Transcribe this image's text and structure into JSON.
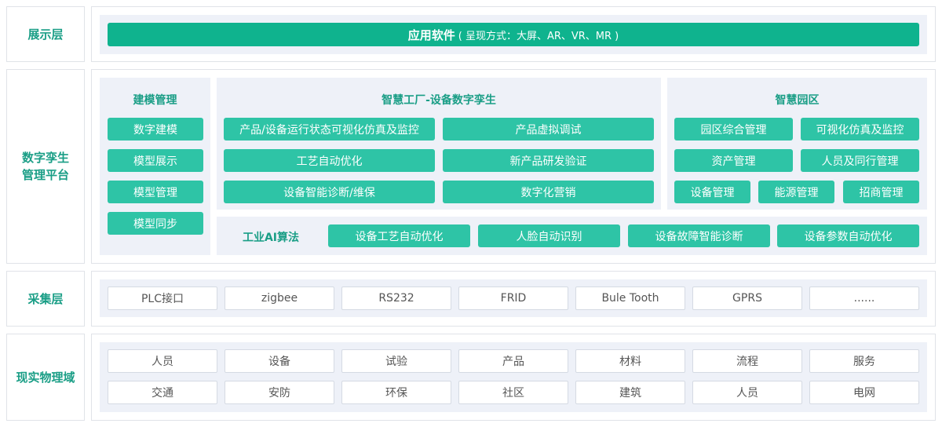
{
  "layers": {
    "display": "展示层",
    "twin": "数字孪生\n管理平台",
    "collect": "采集层",
    "physical": "现实物理域"
  },
  "display_bar": {
    "title": "应用软件",
    "detail": "( 呈现方式：大屏、AR、VR、MR )"
  },
  "modeling": {
    "title": "建模管理",
    "items": [
      "数字建模",
      "模型展示",
      "模型管理",
      "模型同步"
    ]
  },
  "factory": {
    "title": "智慧工厂-设备数字孪生",
    "items": [
      "产品/设备运行状态可视化仿真及监控",
      "产品虚拟调试",
      "工艺自动优化",
      "新产品研发验证",
      "设备智能诊断/维保",
      "数字化营销"
    ]
  },
  "park": {
    "title": "智慧园区",
    "items": [
      "园区综合管理",
      "可视化仿真及监控",
      "资产管理",
      "人员及同行管理",
      "设备管理",
      "能源管理",
      "招商管理"
    ]
  },
  "ai": {
    "title": "工业AI算法",
    "items": [
      "设备工艺自动优化",
      "人脸自动识别",
      "设备故障智能诊断",
      "设备参数自动优化"
    ]
  },
  "collect_items": [
    "PLC接口",
    "zigbee",
    "RS232",
    "FRID",
    "Bule Tooth",
    "GPRS",
    "......"
  ],
  "physical_items": [
    "人员",
    "设备",
    "试验",
    "产品",
    "材料",
    "流程",
    "服务",
    "交通",
    "安防",
    "环保",
    "社区",
    "建筑",
    "人员",
    "电网"
  ],
  "colors": {
    "accent": "#2ec4a6",
    "accent_dark": "#0fb38e",
    "title_text": "#1a9e86",
    "panel_bg": "#eef1f8",
    "border": "#e0e3e8"
  }
}
